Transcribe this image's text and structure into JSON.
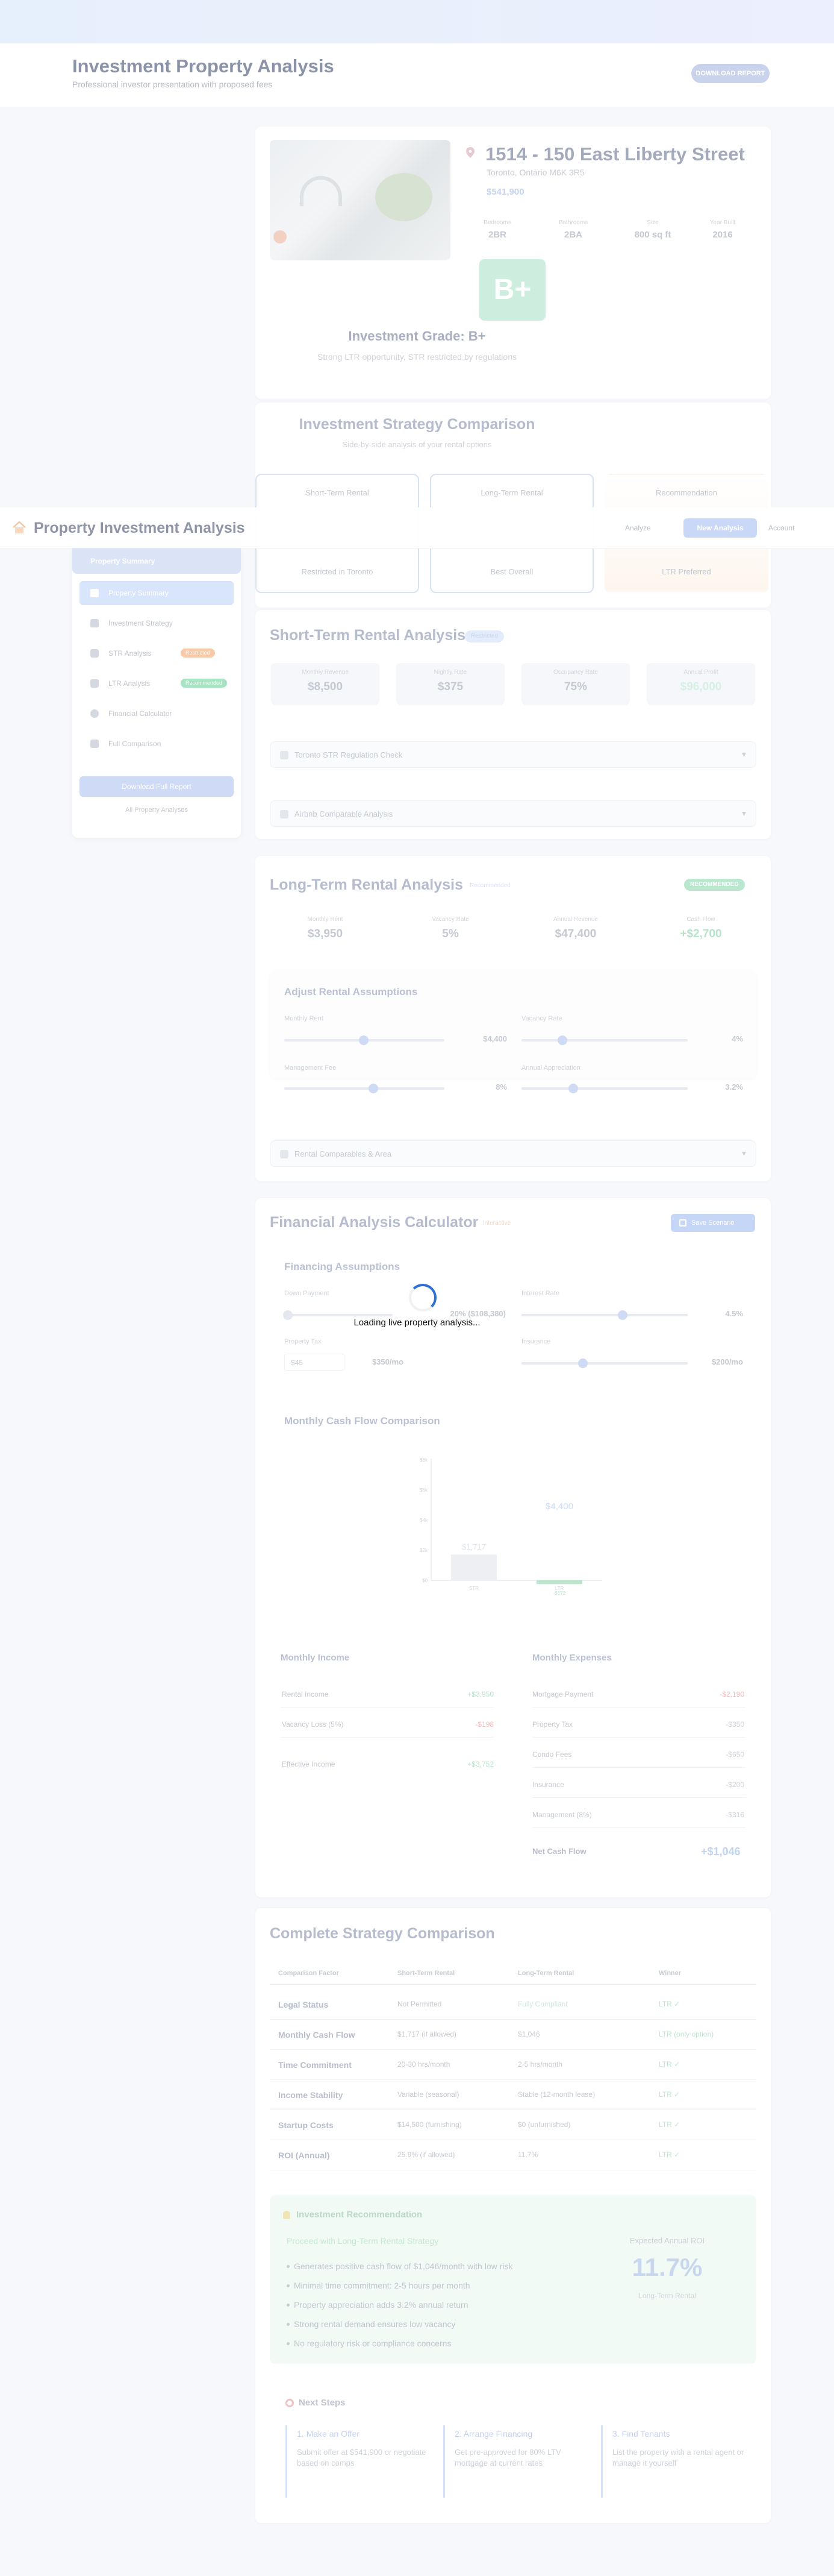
{
  "header": {
    "title": "Investment Property Analysis",
    "subtitle": "Professional investor presentation with proposed fees",
    "cta": "DOWNLOAD REPORT"
  },
  "property": {
    "address": "1514 - 150 East Liberty Street",
    "city": "Toronto, Ontario M6K 3R5",
    "price": "$541,900",
    "specs": [
      {
        "label": "Bedrooms",
        "value": "2BR"
      },
      {
        "label": "Bathrooms",
        "value": "2BA"
      },
      {
        "label": "Size",
        "value": "800 sq ft"
      },
      {
        "label": "Year Built",
        "value": "2016"
      }
    ],
    "grade": "B+",
    "grade_title": "Investment Grade: B+",
    "grade_subtitle": "Strong LTR opportunity, STR restricted by regulations"
  },
  "strategy": {
    "title": "Investment Strategy Comparison",
    "subtitle": "Side-by-side analysis of your rental options",
    "tabs": [
      {
        "top": "Short-Term Rental",
        "bottom": "Restricted in Toronto"
      },
      {
        "top": "Long-Term Rental",
        "bottom": "Best Overall"
      },
      {
        "top": "Recommendation",
        "bottom": "LTR Preferred"
      }
    ]
  },
  "appbar": {
    "name": "Property Investment Analysis",
    "link": "Analyze",
    "button": "New Analysis",
    "ghost": "Account"
  },
  "sidebar": {
    "header": "Property Summary",
    "items": [
      {
        "label": "Property Summary",
        "badge": ""
      },
      {
        "label": "Investment Strategy",
        "badge": ""
      },
      {
        "label": "STR Analysis",
        "badge": "Restricted"
      },
      {
        "label": "LTR Analysis",
        "badge": "Recommended"
      },
      {
        "label": "Financial Calculator",
        "badge": ""
      },
      {
        "label": "Full Comparison",
        "badge": ""
      }
    ],
    "cta": "Download Full Report",
    "footer": "All Property Analyses"
  },
  "str": {
    "title": "Short-Term Rental Analysis",
    "badge": "Restricted",
    "metrics": [
      {
        "label": "Monthly Revenue",
        "value": "$8,500"
      },
      {
        "label": "Nightly Rate",
        "value": "$375"
      },
      {
        "label": "Occupancy Rate",
        "value": "75%"
      },
      {
        "label": "Annual Profit",
        "value": "$96,000"
      }
    ],
    "accordion_1": "Toronto STR Regulation Check",
    "accordion_2": "Airbnb Comparable Analysis"
  },
  "ltr": {
    "title": "Long-Term Rental Analysis",
    "badge": "Recommended",
    "status": "RECOMMENDED",
    "metrics": [
      {
        "label": "Monthly Rent",
        "value": "$3,950"
      },
      {
        "label": "Vacancy Rate",
        "value": "5%"
      },
      {
        "label": "Annual Revenue",
        "value": "$47,400"
      },
      {
        "label": "Cash Flow",
        "value": "+$2,700"
      }
    ],
    "assumptions_title": "Adjust Rental Assumptions",
    "sliders": [
      {
        "label": "Monthly Rent",
        "value": "$4,400"
      },
      {
        "label": "Vacancy Rate",
        "value": "4%"
      },
      {
        "label": "Management Fee",
        "value": "8%"
      },
      {
        "label": "Annual Appreciation",
        "value": "3.2%"
      }
    ],
    "accordion": "Rental Comparables & Area"
  },
  "finance": {
    "title": "Financial Analysis Calculator",
    "badge": "Interactive",
    "button": "Save Scenario",
    "financing_title": "Financing Assumptions",
    "sliders": [
      {
        "label": "Down Payment",
        "value": "20% ($108,380)"
      },
      {
        "label": "Interest Rate",
        "value": "4.5%"
      },
      {
        "label": "Property Tax",
        "value": "$350/mo"
      },
      {
        "label": "Insurance",
        "value": "$200/mo"
      }
    ],
    "property_tax_prefix": "$45",
    "chart_title": "Monthly Cash Flow Comparison",
    "loading": "Loading live property analysis..."
  },
  "chart_data": {
    "type": "bar",
    "title": "Monthly Cash Flow Comparison",
    "categories": [
      "STR",
      "LTR"
    ],
    "series": [
      {
        "name": "",
        "values": [
          1717,
          4400
        ]
      },
      {
        "name": "",
        "values": [
          -172,
          -172
        ]
      }
    ],
    "y_ticks": [
      "$8k",
      "$6k",
      "$4k",
      "$2k",
      "$0"
    ],
    "data_labels": [
      "$1,717",
      "$4,400",
      "-$172"
    ],
    "ylim": [
      0,
      8000
    ]
  },
  "income": {
    "title": "Monthly Income",
    "rows": [
      {
        "label": "Rental Income",
        "value": "+$3,950"
      },
      {
        "label": "Vacancy Loss (5%)",
        "value": "-$198"
      },
      {
        "label": "Effective Income",
        "value": "+$3,752"
      }
    ]
  },
  "expenses": {
    "title": "Monthly Expenses",
    "rows": [
      {
        "label": "Mortgage Payment",
        "value": "-$2,190"
      },
      {
        "label": "Property Tax",
        "value": "-$350"
      },
      {
        "label": "Condo Fees",
        "value": "-$650"
      },
      {
        "label": "Insurance",
        "value": "-$200"
      },
      {
        "label": "Management (8%)",
        "value": "-$316"
      }
    ],
    "net_label": "Net Cash Flow",
    "net_value": "+$1,046"
  },
  "comparison": {
    "title": "Complete Strategy Comparison",
    "headers": [
      "Comparison Factor",
      "Short-Term Rental",
      "Long-Term Rental",
      "Winner"
    ],
    "rows": [
      [
        "Legal Status",
        "Not Permitted",
        "Fully Compliant",
        "LTR ✓"
      ],
      [
        "Monthly Cash Flow",
        "$1,717 (if allowed)",
        "$1,046",
        "LTR (only option)"
      ],
      [
        "Time Commitment",
        "20-30 hrs/month",
        "2-5 hrs/month",
        "LTR ✓"
      ],
      [
        "Income Stability",
        "Variable (seasonal)",
        "Stable (12-month lease)",
        "LTR ✓"
      ],
      [
        "Startup Costs",
        "$14,500 (furnishing)",
        "$0 (unfurnished)",
        "LTR ✓"
      ],
      [
        "ROI (Annual)",
        "25.9% (if allowed)",
        "11.7%",
        "LTR ✓"
      ]
    ]
  },
  "recommendation": {
    "title": "Investment Recommendation",
    "verdict": "Proceed with Long-Term Rental Strategy",
    "bullets": [
      "Generates positive cash flow of $1,046/month with low risk",
      "Minimal time commitment: 2-5 hours per month",
      "Property appreciation adds 3.2% annual return",
      "Strong rental demand ensures low vacancy",
      "No regulatory risk or compliance concerns"
    ],
    "roi_label": "Expected Annual ROI",
    "roi_value": "11.7%",
    "roi_sub": "Long-Term Rental"
  },
  "next_steps": {
    "title": "Next Steps",
    "cols": [
      {
        "head": "1. Make an Offer",
        "body": "Submit offer at $541,900 or negotiate based on comps"
      },
      {
        "head": "2. Arrange Financing",
        "body": "Get pre-approved for 80% LTV mortgage at current rates"
      },
      {
        "head": "3. Find Tenants",
        "body": "List the property with a rental agent or manage it yourself"
      }
    ]
  },
  "colors": {
    "accent": "#2e6fd8",
    "restricted": "#f5b18a",
    "recommended": "#7fd6a8"
  }
}
